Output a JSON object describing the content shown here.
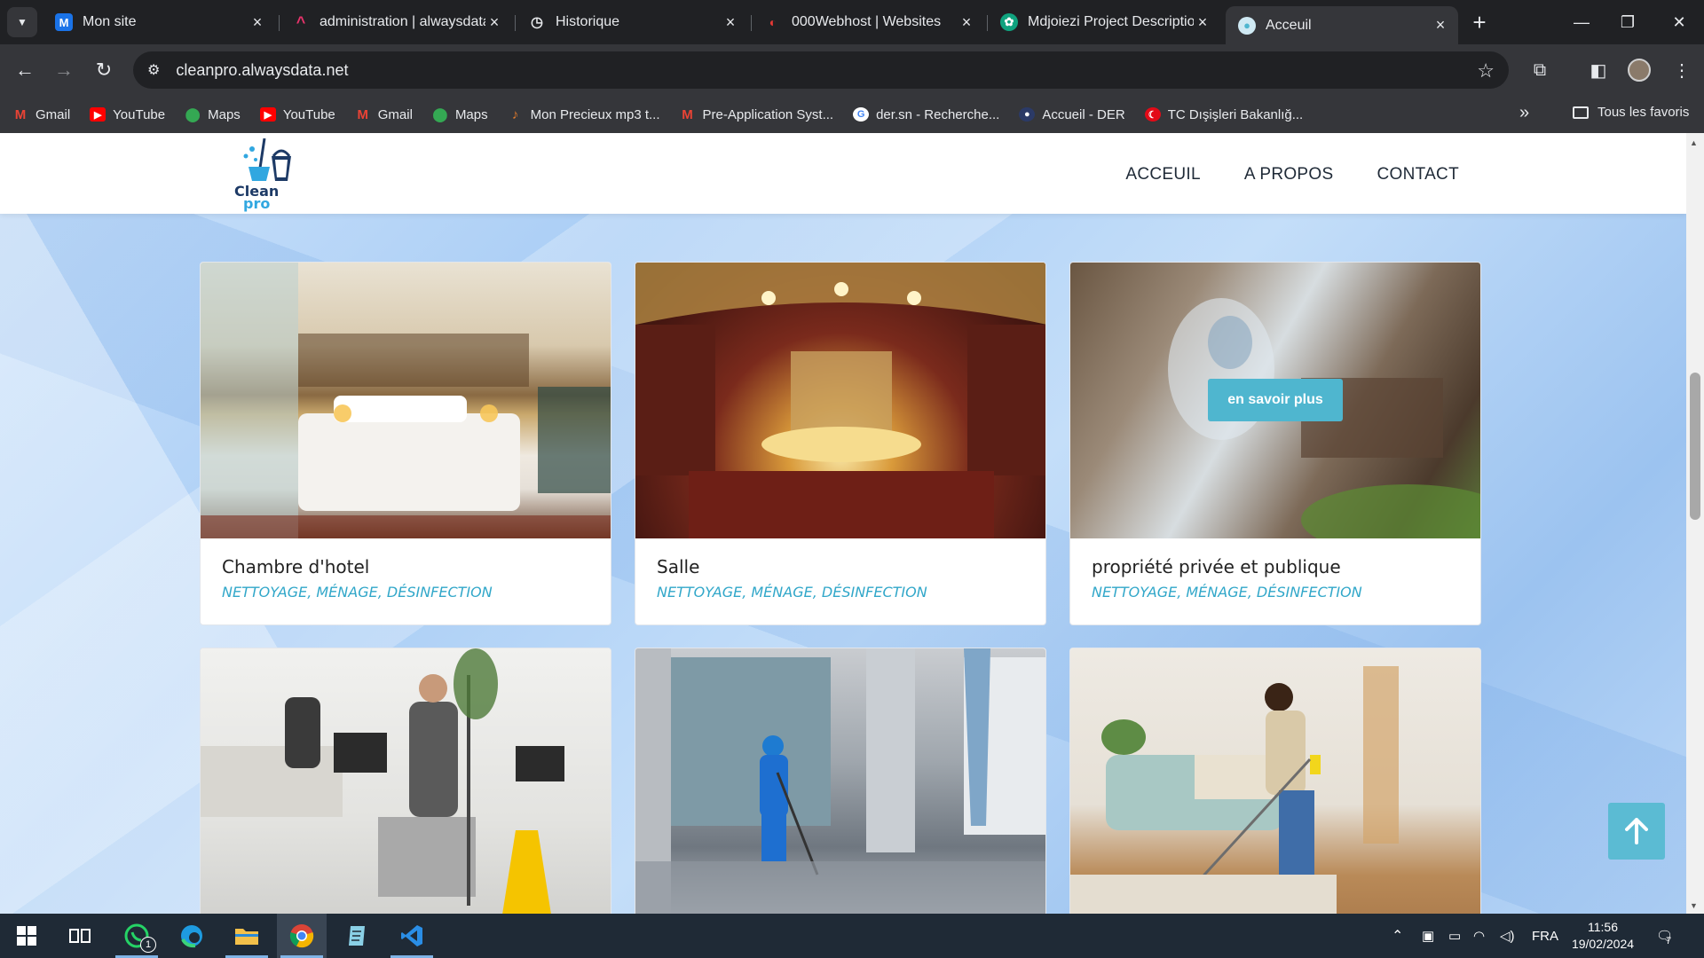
{
  "browser": {
    "tabs": [
      {
        "title": "Mon site",
        "favicon": "site-icon",
        "color": "#1a73e8"
      },
      {
        "title": "administration | alwaysdata",
        "favicon": "alwaysdata-icon",
        "color": "#e8336b"
      },
      {
        "title": "Historique",
        "favicon": "history-icon",
        "color": "#5f6368"
      },
      {
        "title": "000Webhost | Websites",
        "favicon": "000webhost-icon",
        "color": "#e53935"
      },
      {
        "title": "Mdjoiezi Project Descriptio",
        "favicon": "chatgpt-icon",
        "color": "#10a37f"
      },
      {
        "title": "Acceuil",
        "favicon": "cleanpro-icon",
        "color": "#4fb6cf"
      }
    ],
    "url": "cleanpro.alwaysdata.net",
    "bookmarks": [
      {
        "label": "Gmail",
        "icon": "gmail-icon",
        "color": "#ea4335"
      },
      {
        "label": "YouTube",
        "icon": "youtube-icon",
        "color": "#ff0000"
      },
      {
        "label": "Maps",
        "icon": "maps-icon",
        "color": "#34a853"
      },
      {
        "label": "YouTube",
        "icon": "youtube-icon",
        "color": "#ff0000"
      },
      {
        "label": "Gmail",
        "icon": "gmail-icon",
        "color": "#ea4335"
      },
      {
        "label": "Maps",
        "icon": "maps-icon",
        "color": "#34a853"
      },
      {
        "label": "Mon Precieux mp3 t...",
        "icon": "music-icon",
        "color": "#e07a2c"
      },
      {
        "label": "Pre-Application Syst...",
        "icon": "gmail-icon",
        "color": "#ea4335"
      },
      {
        "label": "der.sn - Recherche...",
        "icon": "google-icon",
        "color": "#4285f4"
      },
      {
        "label": "Accueil - DER",
        "icon": "der-icon",
        "color": "#2b3a67"
      },
      {
        "label": "TC Dışişleri Bakanlığ...",
        "icon": "turkey-icon",
        "color": "#e30a17"
      }
    ],
    "all_bookmarks": "Tous les favoris"
  },
  "site": {
    "logo": {
      "line1": "Clean",
      "line2": "pro"
    },
    "nav": [
      "ACCEUIL",
      "A PROPOS",
      "CONTACT"
    ],
    "cards": [
      {
        "title": "Chambre d'hotel",
        "tags": "NETTOYAGE, MÉNAGE, DÉSINFECTION",
        "image": "hotel-room"
      },
      {
        "title": "Salle",
        "tags": "NETTOYAGE, MÉNAGE, DÉSINFECTION",
        "image": "theater-hall"
      },
      {
        "title": "propriété privée et publique",
        "tags": "NETTOYAGE, MÉNAGE, DÉSINFECTION",
        "image": "blurred-cleaning",
        "overlay_button": "en savoir plus"
      },
      {
        "title": "",
        "tags": "",
        "image": "office-cleaners"
      },
      {
        "title": "",
        "tags": "",
        "image": "lobby-mopping"
      },
      {
        "title": "",
        "tags": "",
        "image": "living-room-mopping"
      }
    ],
    "accent": "#4fb6cf"
  },
  "taskbar": {
    "whatsapp_badge": "1",
    "language": "FRA",
    "time": "11:56",
    "date": "19/02/2024",
    "notification_count": "7"
  }
}
